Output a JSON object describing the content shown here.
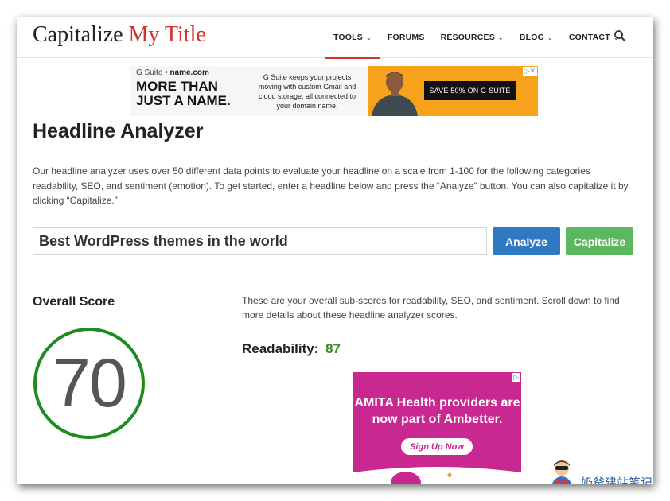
{
  "header": {
    "logo_part1": "Capitalize",
    "logo_part2": "My Title",
    "nav": [
      {
        "label": "TOOLS",
        "dropdown": true,
        "active": true
      },
      {
        "label": "FORUMS",
        "dropdown": false,
        "active": false
      },
      {
        "label": "RESOURCES",
        "dropdown": true,
        "active": false
      },
      {
        "label": "BLOG",
        "dropdown": true,
        "active": false
      },
      {
        "label": "CONTACT",
        "dropdown": true,
        "active": false
      }
    ],
    "search_icon": "search-icon"
  },
  "ad_top": {
    "brand1": "G Suite",
    "brand_sep": "•",
    "brand2": "name.com",
    "headline_line1": "MORE THAN",
    "headline_line2": "JUST A NAME.",
    "body": "G Suite keeps your projects moving with custom Gmail and cloud storage, all connected to your domain name.",
    "cta": "SAVE 50% ON G SUITE",
    "adchoice": "▷✕"
  },
  "main": {
    "title": "Headline Analyzer",
    "intro": "Our headline analyzer uses over 50 different data points to evaluate your headline on a scale from 1-100 for the following categories readability, SEO, and sentiment (emotion). To get started, enter a headline below and press the “Analyze” button. You can also capitalize it by clicking “Capitalize.”",
    "headline_value": "Best WordPress themes in the world",
    "analyze_label": "Analyze",
    "capitalize_label": "Capitalize"
  },
  "score": {
    "label": "Overall Score",
    "value": "70",
    "ring_color": "#1f8a1f"
  },
  "subscores": {
    "text": "These are your overall sub-scores for readability, SEO, and sentiment. Scroll down to find more details about these headline analyzer scores.",
    "readability_label": "Readability:",
    "readability_value": "87"
  },
  "ad_right": {
    "text": "AMITA Health providers are now part of Ambetter.",
    "signup": "Sign Up Now",
    "adchoice": "▷"
  },
  "watermark": {
    "text": "奶爸建站笔记"
  },
  "colors": {
    "accent_red": "#d0342c",
    "analyze_blue": "#2f78c2",
    "capitalize_green": "#5cb85c",
    "readability_green": "#3a8a1e",
    "ad_magenta": "#c8288f",
    "ad_orange": "#f7a21b"
  }
}
